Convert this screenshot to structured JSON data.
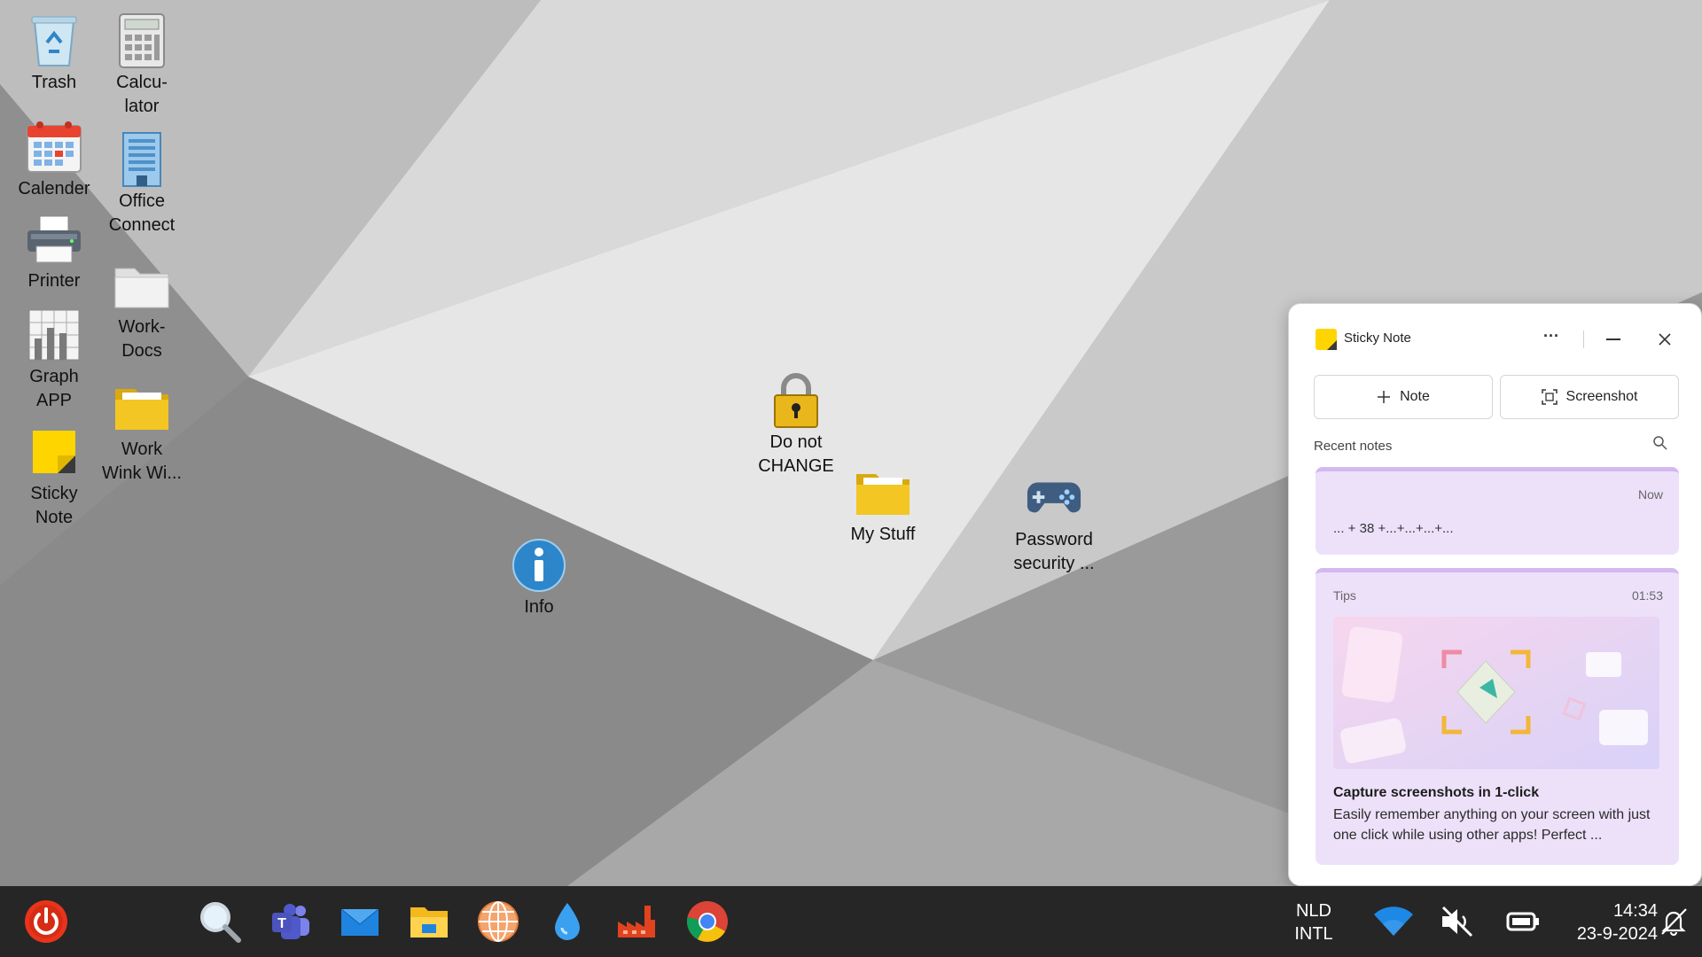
{
  "desktop": {
    "icons": [
      {
        "id": "trash",
        "label": "Trash",
        "icon": "recycle-bin-icon"
      },
      {
        "id": "calculator",
        "label": "Calcu-\nlator",
        "icon": "calculator-icon"
      },
      {
        "id": "calender",
        "label": "Calender",
        "icon": "calendar-icon"
      },
      {
        "id": "office-connect",
        "label": "Office\nConnect",
        "icon": "office-building-icon"
      },
      {
        "id": "printer",
        "label": "Printer",
        "icon": "printer-icon"
      },
      {
        "id": "work-docs",
        "label": "Work-\nDocs",
        "icon": "folder-icon"
      },
      {
        "id": "graph-app",
        "label": "Graph\nAPP",
        "icon": "graph-icon"
      },
      {
        "id": "work-wink",
        "label": "Work\nWink Wi...",
        "icon": "folder-icon"
      },
      {
        "id": "sticky-note",
        "label": "Sticky\nNote",
        "icon": "sticky-note-icon"
      },
      {
        "id": "do-not-change",
        "label": "Do not\nCHANGE",
        "icon": "padlock-icon"
      },
      {
        "id": "my-stuff",
        "label": "My Stuff",
        "icon": "folder-icon"
      },
      {
        "id": "password-security",
        "label": "Password\nsecurity ...",
        "icon": "gamepad-icon"
      },
      {
        "id": "info",
        "label": "Info",
        "icon": "info-icon"
      }
    ]
  },
  "sticky_panel": {
    "title": "Sticky Note",
    "more_label": "···",
    "note_button": "Note",
    "screenshot_button": "Screenshot",
    "recent_label": "Recent notes",
    "notes": [
      {
        "time": "Now",
        "text": "... + 38 +...+...+...+..."
      }
    ],
    "tip": {
      "label": "Tips",
      "time": "01:53",
      "heading": "Capture screenshots in 1-click",
      "body": "Easily remember anything on your screen with just one click while using other apps! Perfect ..."
    }
  },
  "taskbar": {
    "apps": [
      "power-icon",
      "search-icon",
      "teams-icon",
      "mail-icon",
      "file-explorer-icon",
      "globe-icon",
      "water-drop-icon",
      "factory-icon",
      "chrome-icon"
    ],
    "keyboard_lang": "NLD",
    "keyboard_layout": "INTL",
    "time": "14:34",
    "date": "23-9-2024"
  },
  "colors": {
    "taskbar_bg": "#262626",
    "sticky_accent": "#ede1fa",
    "power_red": "#e8341c"
  }
}
